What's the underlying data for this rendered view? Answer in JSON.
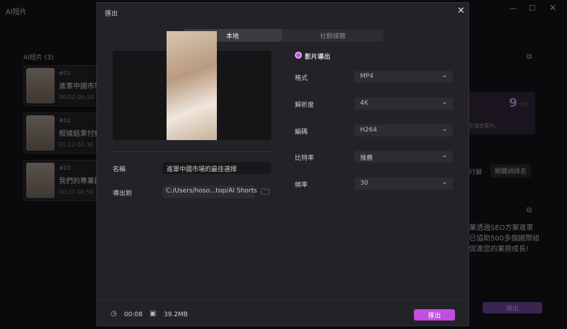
{
  "app": {
    "title": "AI短片",
    "list_heading": "AI短片 (3)",
    "clips": [
      {
        "num": "#01",
        "title": "進軍中國市場",
        "time": "00:02-00:10"
      },
      {
        "num": "#02",
        "title": "根據結果付費",
        "time": "01:12-01:30"
      },
      {
        "num": "#03",
        "title": "我們的專業團",
        "time": "00:37-00:50"
      }
    ],
    "right": {
      "score": "9",
      "score_unit": "/10",
      "desc": "引潛在客戶。",
      "tags": [
        "行銷",
        "關鍵詞排名"
      ],
      "body": "業透過SEO方案進軍 已協助500多個國際組 促進您的業務成長!",
      "export_label": "導出"
    }
  },
  "modal": {
    "title": "匯出",
    "tabs": [
      {
        "label": "本地"
      },
      {
        "label": "社群媒體"
      }
    ],
    "name_label": "名稱",
    "name_value": "進軍中國市場的最佳選擇",
    "export_to_label": "導出到",
    "export_path": "C:/Users/hoso...top/AI Shorts",
    "video_export": "影片導出",
    "settings": [
      {
        "label": "格式",
        "value": "MP4"
      },
      {
        "label": "解析度",
        "value": "4K"
      },
      {
        "label": "編碼",
        "value": "H264"
      },
      {
        "label": "比特率",
        "value": "推薦"
      },
      {
        "label": "幀率",
        "value": "30"
      }
    ],
    "duration": "00:08",
    "size": "39.2MB",
    "export_button": "匯出"
  },
  "colors": {
    "accent": "#c04ee0"
  }
}
